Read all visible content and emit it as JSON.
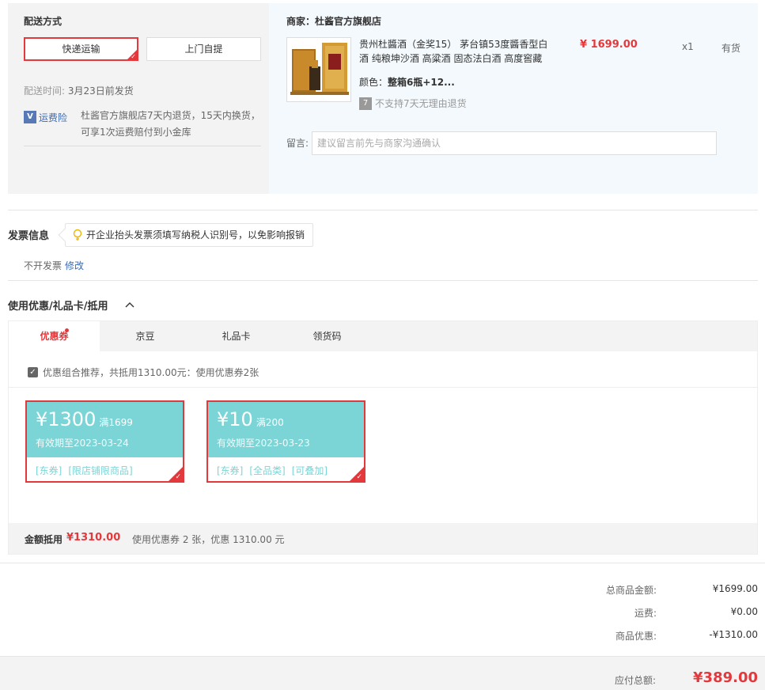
{
  "shipping": {
    "title": "配送方式",
    "methods": [
      "快递运输",
      "上门自提"
    ],
    "time_label": "配送时间:",
    "time_value": "3月23日前发货",
    "insurance_badge": "V",
    "insurance_label": "运费险",
    "insurance_desc": "杜酱官方旗舰店7天内退货，15天内换货，可享1次运费赔付到小金库"
  },
  "store": {
    "title": "商家：杜酱官方旗舰店",
    "product_name": "贵州杜醬酒（金奖15） 茅台镇53度醬香型白酒 纯粮坤沙酒 高粱酒 固态法白酒 高度窖藏",
    "price": "¥ 1699.00",
    "qty": "x1",
    "stock": "有货",
    "color_label": "颜色：",
    "color_value": "整箱6瓶+12...",
    "return_icon": "7",
    "return_text": "不支持7天无理由退货",
    "note_label": "留言:",
    "note_placeholder": "建议留言前先与商家沟通确认",
    "note_value": ""
  },
  "invoice": {
    "title": "发票信息",
    "tip": "开企业抬头发票须填写纳税人识别号，以免影响报销",
    "status": "不开发票",
    "edit": "修改"
  },
  "coupons": {
    "title": "使用优惠/礼品卡/抵用",
    "tabs": [
      "优惠券",
      "京豆",
      "礼品卡",
      "领货码"
    ],
    "active_tab": 0,
    "combo_text": "优惠组合推荐，共抵用1310.00元：使用优惠券2张",
    "items": [
      {
        "amount": "¥1300",
        "condition": "满1699",
        "expiry": "有效期至2023-03-24",
        "tags": [
          "[东券]",
          "[限店铺限商品]"
        ]
      },
      {
        "amount": "¥10",
        "condition": "满200",
        "expiry": "有效期至2023-03-23",
        "tags": [
          "[东券]",
          "[全品类]",
          "[可叠加]"
        ]
      }
    ],
    "footer_label": "金额抵用",
    "footer_amount": "¥1310.00",
    "footer_desc": "使用优惠券 2 张，优惠 1310.00 元"
  },
  "summary": {
    "rows": [
      {
        "label": "总商品金额:",
        "value": "¥1699.00"
      },
      {
        "label": "运费:",
        "value": "¥0.00"
      },
      {
        "label": "商品优惠:",
        "value": "-¥1310.00"
      }
    ],
    "total_label": "应付总额:",
    "total_value": "¥389.00"
  },
  "colors": {
    "accent": "#e4393c",
    "coupon": "#7bd4d6",
    "link": "#3a6bb5"
  }
}
